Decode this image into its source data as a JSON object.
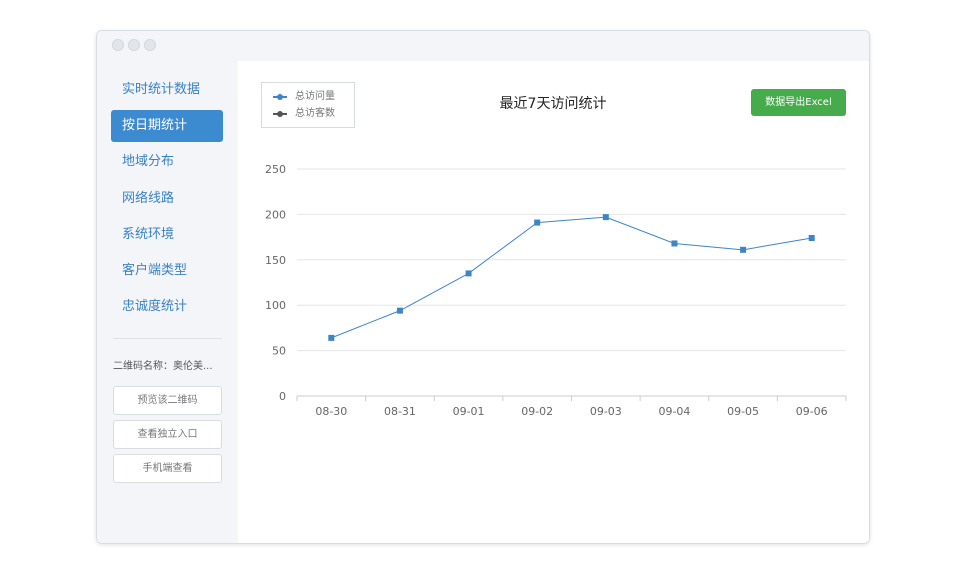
{
  "window": {
    "controls": [
      "close",
      "minimize",
      "maximize"
    ]
  },
  "sidebar": {
    "items": [
      {
        "label": "实时统计数据",
        "active": false
      },
      {
        "label": "按日期统计",
        "active": true
      },
      {
        "label": "地域分布",
        "active": false
      },
      {
        "label": "网络线路",
        "active": false
      },
      {
        "label": "系统环境",
        "active": false
      },
      {
        "label": "客户端类型",
        "active": false
      },
      {
        "label": "忠诚度统计",
        "active": false
      }
    ],
    "qr_name": "二维码名称：奥伦美...",
    "buttons": {
      "preview": "预览该二维码",
      "view_entry": "查看独立入口",
      "mobile_view": "手机端查看"
    }
  },
  "header": {
    "title": "最近7天访问统计",
    "export_label": "数据导出Excel"
  },
  "colors": {
    "series_pv": "#3d85c6",
    "series_uv": "#555555",
    "export": "#45ab4b",
    "active_nav": "#3c8ad0"
  },
  "chart_data": {
    "type": "line",
    "title": "最近7天访问统计",
    "categories": [
      "08-30",
      "08-31",
      "09-01",
      "09-02",
      "09-03",
      "09-04",
      "09-05",
      "09-06"
    ],
    "y_ticks": [
      0,
      50,
      100,
      150,
      200,
      250
    ],
    "ylim": [
      0,
      250
    ],
    "grid": true,
    "legend_position": "top-left",
    "series": [
      {
        "name": "总访问量",
        "values": [
          64,
          94,
          135,
          191,
          197,
          168,
          161,
          174
        ],
        "color": "#3d85c6"
      },
      {
        "name": "总访客数",
        "values": [],
        "color": "#555555"
      }
    ]
  }
}
